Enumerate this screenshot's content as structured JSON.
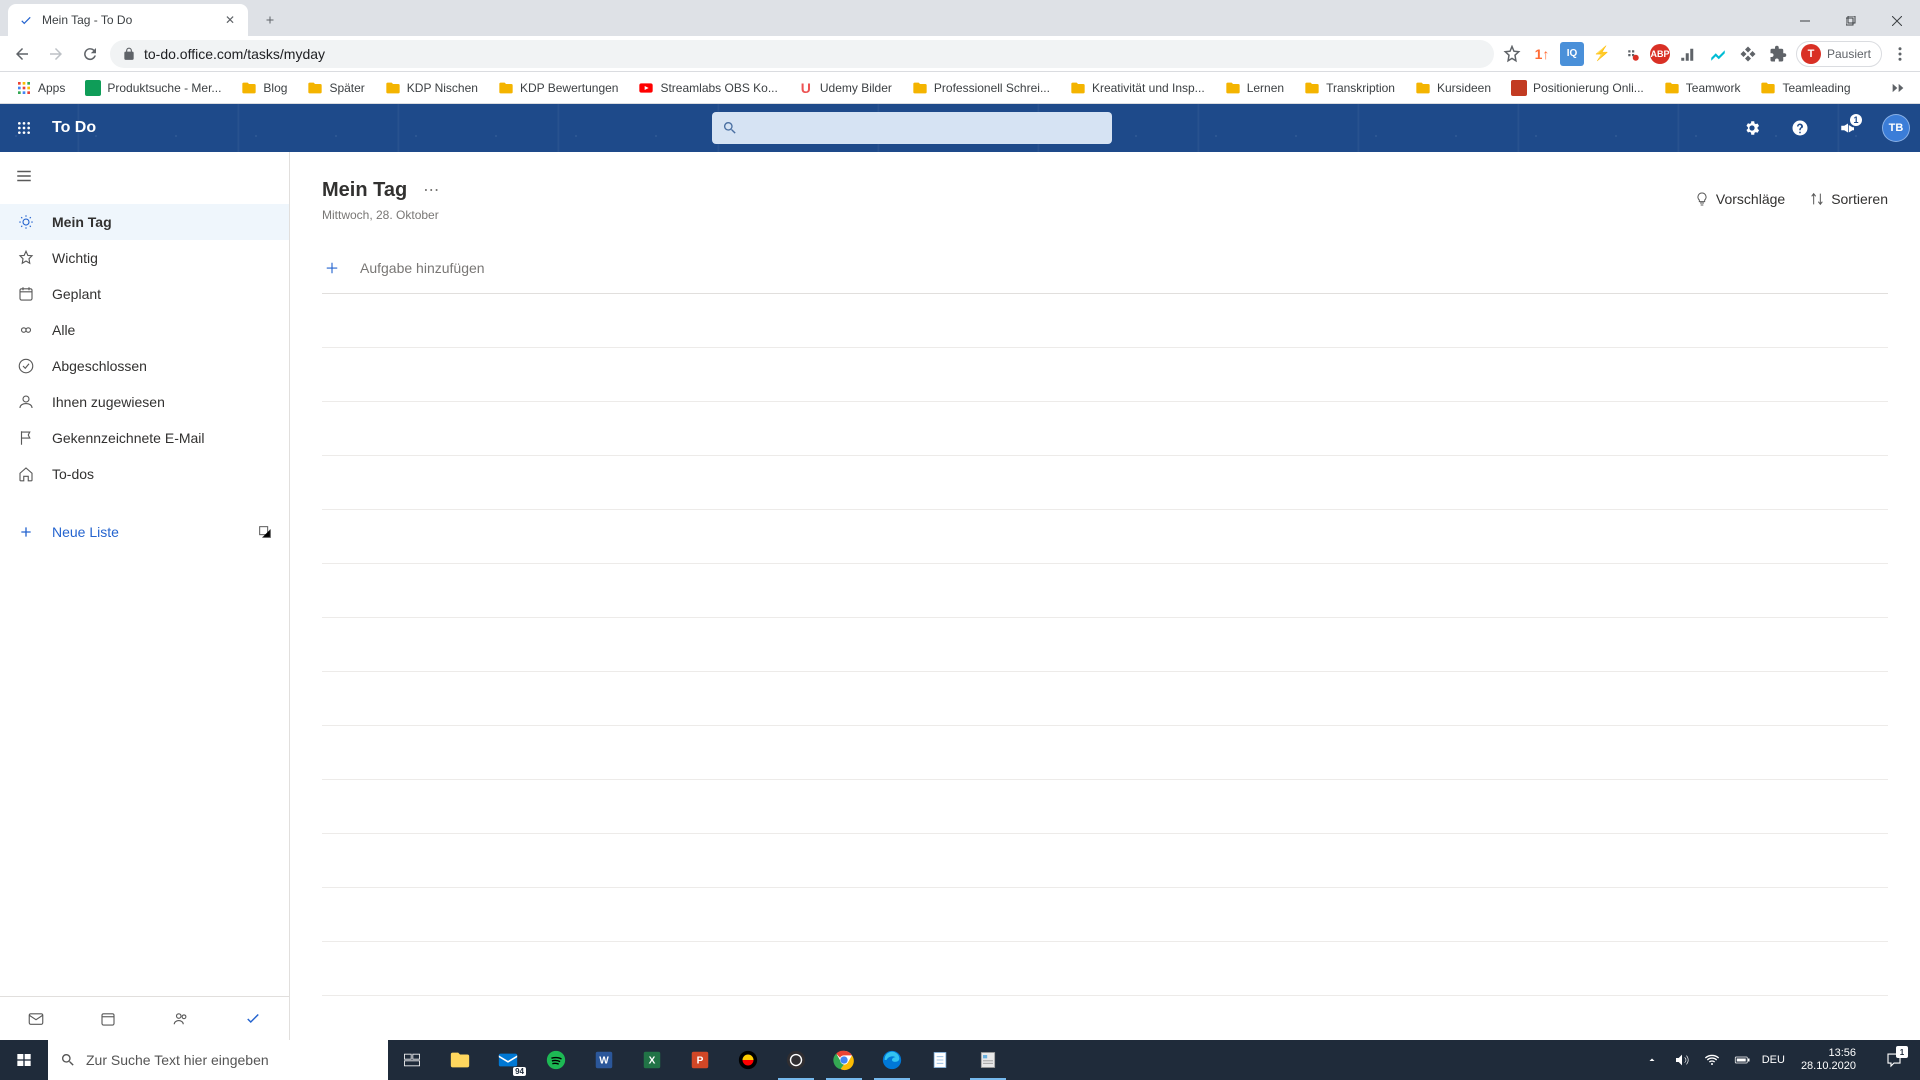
{
  "browser": {
    "tab_title": "Mein Tag - To Do",
    "url": "to-do.office.com/tasks/myday",
    "profile_status": "Pausiert",
    "profile_initial": "T"
  },
  "bookmarks": [
    {
      "label": "Apps",
      "type": "apps"
    },
    {
      "label": "Produktsuche - Mer...",
      "type": "site-green"
    },
    {
      "label": "Blog",
      "type": "folder"
    },
    {
      "label": "Später",
      "type": "folder"
    },
    {
      "label": "KDP Nischen",
      "type": "folder"
    },
    {
      "label": "KDP Bewertungen",
      "type": "folder"
    },
    {
      "label": "Streamlabs OBS Ko...",
      "type": "youtube"
    },
    {
      "label": "Udemy Bilder",
      "type": "udemy"
    },
    {
      "label": "Professionell Schrei...",
      "type": "folder"
    },
    {
      "label": "Kreativität und Insp...",
      "type": "folder"
    },
    {
      "label": "Lernen",
      "type": "folder"
    },
    {
      "label": "Transkription",
      "type": "folder"
    },
    {
      "label": "Kursideen",
      "type": "folder"
    },
    {
      "label": "Positionierung Onli...",
      "type": "site-red"
    },
    {
      "label": "Teamwork",
      "type": "folder"
    },
    {
      "label": "Teamleading",
      "type": "folder"
    }
  ],
  "app": {
    "name": "To Do",
    "search_placeholder": "",
    "notification_count": "1",
    "avatar_initials": "TB"
  },
  "sidebar": {
    "items": [
      {
        "label": "Mein Tag",
        "icon": "sun",
        "active": true
      },
      {
        "label": "Wichtig",
        "icon": "star",
        "active": false
      },
      {
        "label": "Geplant",
        "icon": "calendar",
        "active": false
      },
      {
        "label": "Alle",
        "icon": "infinity",
        "active": false
      },
      {
        "label": "Abgeschlossen",
        "icon": "check-circle",
        "active": false
      },
      {
        "label": "Ihnen zugewiesen",
        "icon": "person",
        "active": false
      },
      {
        "label": "Gekennzeichnete E-Mail",
        "icon": "flag",
        "active": false
      },
      {
        "label": "To-dos",
        "icon": "home",
        "active": false
      }
    ],
    "new_list_label": "Neue Liste"
  },
  "content": {
    "title": "Mein Tag",
    "date": "Mittwoch, 28. Oktober",
    "suggestions_label": "Vorschläge",
    "sort_label": "Sortieren",
    "add_task_placeholder": "Aufgabe hinzufügen"
  },
  "taskbar": {
    "search_placeholder": "Zur Suche Text hier eingeben",
    "mail_badge": "94",
    "lang": "DEU",
    "time": "13:56",
    "date": "28.10.2020",
    "notif_count": "1"
  }
}
